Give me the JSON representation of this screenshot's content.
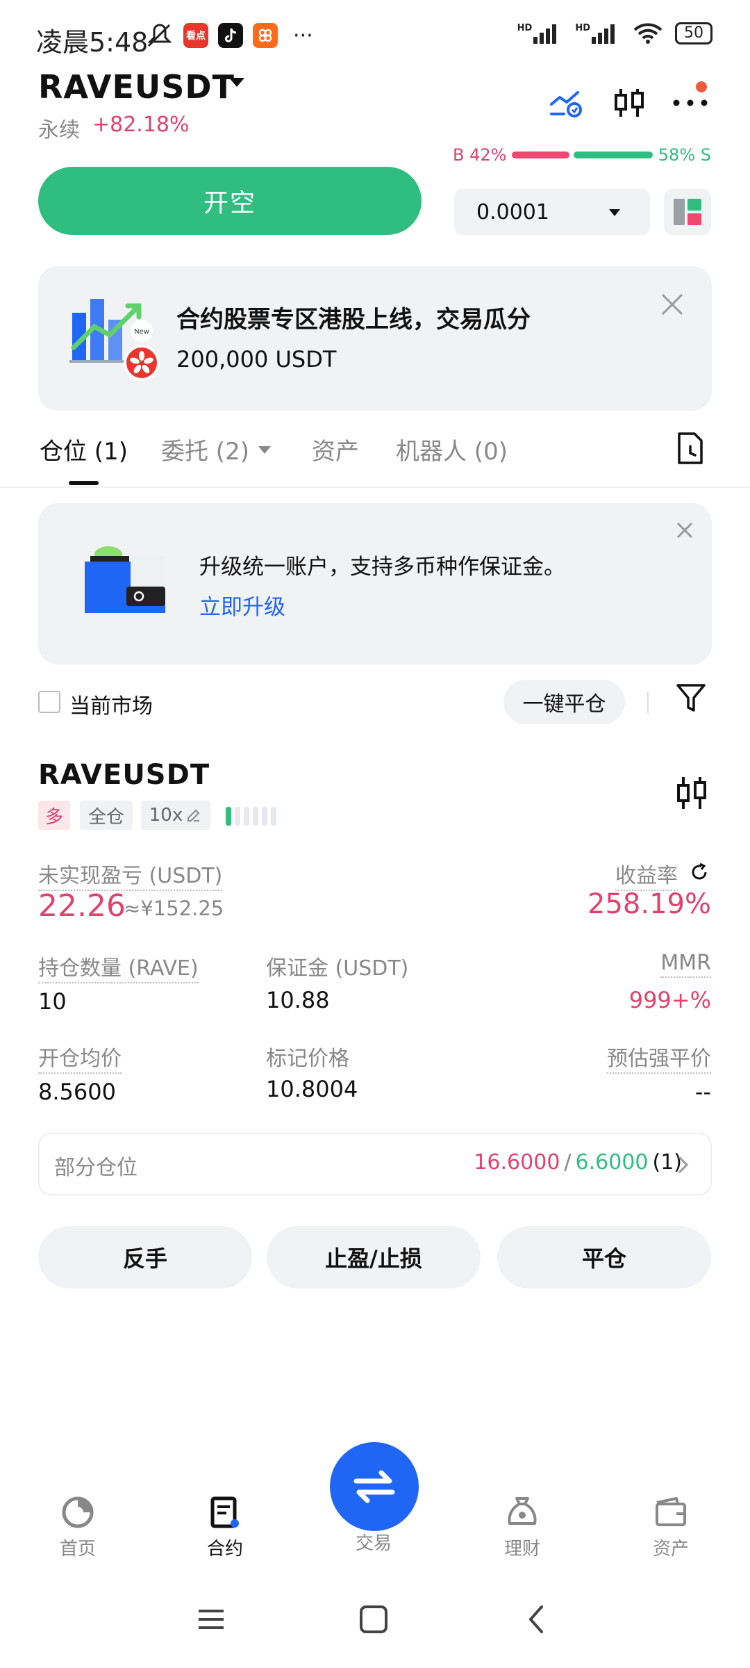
{
  "status_bar": {
    "time": "凌晨5:48",
    "more": "···",
    "battery": "50",
    "network_1": "HD",
    "network_2": "HD",
    "app_icon_1": "看点"
  },
  "header": {
    "pair": "RAVEUSDT",
    "contract_type": "永续",
    "change": "+82.18%",
    "icons": [
      "chart-analysis-icon",
      "candlestick-icon",
      "more-icon"
    ]
  },
  "order": {
    "open_short_label": "开空",
    "buy_ratio": "B 42%",
    "sell_ratio": "58% S",
    "buy_ratio_value": 0.42,
    "precision": "0.0001"
  },
  "promo": {
    "title": "合约股票专区港股上线，交易瓜分",
    "amount": "200,000 USDT",
    "new_tag": "New"
  },
  "tabs": [
    {
      "label": "仓位 (1)"
    },
    {
      "label": "委托 (2)"
    },
    {
      "label": "资产"
    },
    {
      "label": "机器人 (0)"
    }
  ],
  "upgrade": {
    "text": "升级统一账户，支持多币种作保证金。",
    "link": "立即升级"
  },
  "filter": {
    "current_market": "当前市场",
    "close_all": "一键平仓"
  },
  "position": {
    "symbol": "RAVEUSDT",
    "side": "多",
    "margin_mode": "全仓",
    "leverage": "10x",
    "pnl_label": "未实现盈亏 (USDT)",
    "pnl": "22.26",
    "pnl_cny": "≈¥152.25",
    "roe_label": "收益率",
    "roe": "258.19%",
    "size_label": "持仓数量 (RAVE)",
    "size": "10",
    "margin_label": "保证金 (USDT)",
    "margin": "10.88",
    "mmr_label": "MMR",
    "mmr": "999+%",
    "entry_label": "开仓均价",
    "entry": "8.5600",
    "mark_label": "标记价格",
    "mark": "10.8004",
    "liq_label": "预估强平价",
    "liq": "--",
    "risk_level": 1
  },
  "partial": {
    "label": "部分仓位",
    "tp": "16.6000",
    "sep": "/",
    "sl": "6.6000",
    "count": "(1)"
  },
  "actions": {
    "reverse": "反手",
    "tpsl": "止盈/止损",
    "close": "平仓"
  },
  "bottom_nav": [
    {
      "label": "首页"
    },
    {
      "label": "合约"
    },
    {
      "label": "交易"
    },
    {
      "label": "理财"
    },
    {
      "label": "资产"
    }
  ],
  "colors": {
    "green": "#2fbe80",
    "red": "#e0426d",
    "blue": "#1f66f5"
  }
}
